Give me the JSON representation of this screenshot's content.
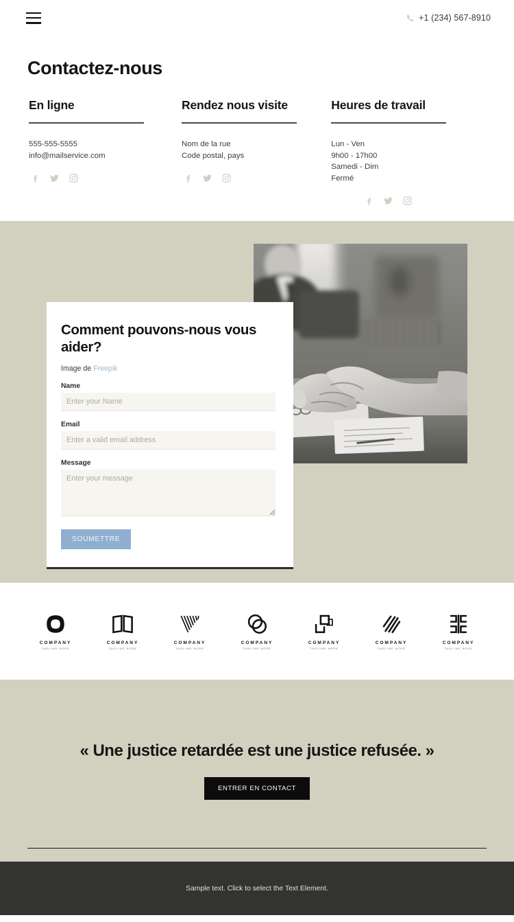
{
  "header": {
    "menu_icon": "hamburger-icon",
    "phone_icon": "phone-icon",
    "phone": "+1 (234) 567-8910"
  },
  "contact": {
    "title": "Contactez-nous",
    "columns": [
      {
        "heading": "En ligne",
        "lines": [
          "555-555-5555",
          "info@mailservice.com"
        ],
        "socials": [
          "facebook-icon",
          "twitter-icon",
          "instagram-icon"
        ]
      },
      {
        "heading": "Rendez nous visite",
        "lines": [
          "Nom de la rue",
          "Code postal, pays"
        ],
        "socials": [
          "facebook-icon",
          "twitter-icon",
          "instagram-icon"
        ]
      },
      {
        "heading": "Heures de travail",
        "lines": [
          "Lun - Ven",
          "9h00 - 17h00",
          "Samedi - Dim",
          "Fermé"
        ],
        "socials": [
          "facebook-icon",
          "twitter-icon",
          "instagram-icon"
        ]
      }
    ]
  },
  "form": {
    "title": "Comment pouvons-nous vous aider?",
    "credit_prefix": "Image de ",
    "credit_link": "Freepik",
    "fields": [
      {
        "label": "Name",
        "placeholder": "Enter your Name",
        "value": ""
      },
      {
        "label": "Email",
        "placeholder": "Enter a valid email address",
        "value": ""
      },
      {
        "label": "Message",
        "placeholder": "Enter your message",
        "value": ""
      }
    ],
    "submit_label": "SOUMETTRE",
    "photo_alt": "handshake-photo"
  },
  "logos": [
    {
      "name": "COMPANY",
      "tagline": "TAGLINE HERE",
      "mark": "rounded-square-o-logo"
    },
    {
      "name": "COMPANY",
      "tagline": "TAGLINE HERE",
      "mark": "open-book-logo"
    },
    {
      "name": "COMPANY",
      "tagline": "TAGLINE HERE",
      "mark": "striped-v-logo"
    },
    {
      "name": "COMPANY",
      "tagline": "TAGLINE HERE",
      "mark": "double-circle-logo"
    },
    {
      "name": "COMPANY",
      "tagline": "TAGLINE HERE",
      "mark": "squares-corner-logo"
    },
    {
      "name": "COMPANY",
      "tagline": "TAGLINE HERE",
      "mark": "diagonal-lines-logo"
    },
    {
      "name": "COMPANY",
      "tagline": "TAGLINE HERE",
      "mark": "mirrored-bracket-logo"
    }
  ],
  "quote": {
    "text": "« Une justice retardée est une justice refusée. »",
    "cta_label": "ENTRER EN CONTACT"
  },
  "footer": {
    "text": "Sample text. Click to select the Text Element."
  },
  "colors": {
    "beige": "#d2d1c0",
    "dark": "#333331",
    "submit_blue": "#8fafd0",
    "link_blue": "#9fb6cc",
    "social_gray": "#d0cfc2"
  }
}
